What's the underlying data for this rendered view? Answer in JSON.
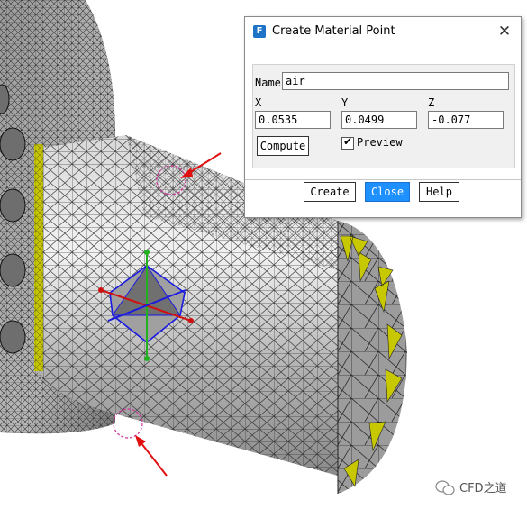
{
  "dialog": {
    "title": "Create Material Point",
    "app_icon_letter": "F",
    "close_glyph": "✕",
    "name_label": "Name",
    "name_value": "air",
    "x_label": "X",
    "y_label": "Y",
    "z_label": "Z",
    "x_value": "0.0535",
    "y_value": "0.0499",
    "z_value": "-0.077",
    "compute_label": "Compute",
    "preview_label": "Preview",
    "preview_checked": true,
    "create_label": "Create",
    "close_label": "Close",
    "help_label": "Help"
  },
  "watermark": {
    "text": "CFD之道",
    "icon": "wechat-icon"
  },
  "colors": {
    "mesh_fill": "#a8a8a8",
    "mesh_lines": "#222222",
    "highlight_face": "#c8c800",
    "annotation_arrow": "#e01010",
    "annotation_circle": "#d0309a",
    "accent": "#1e90ff"
  }
}
